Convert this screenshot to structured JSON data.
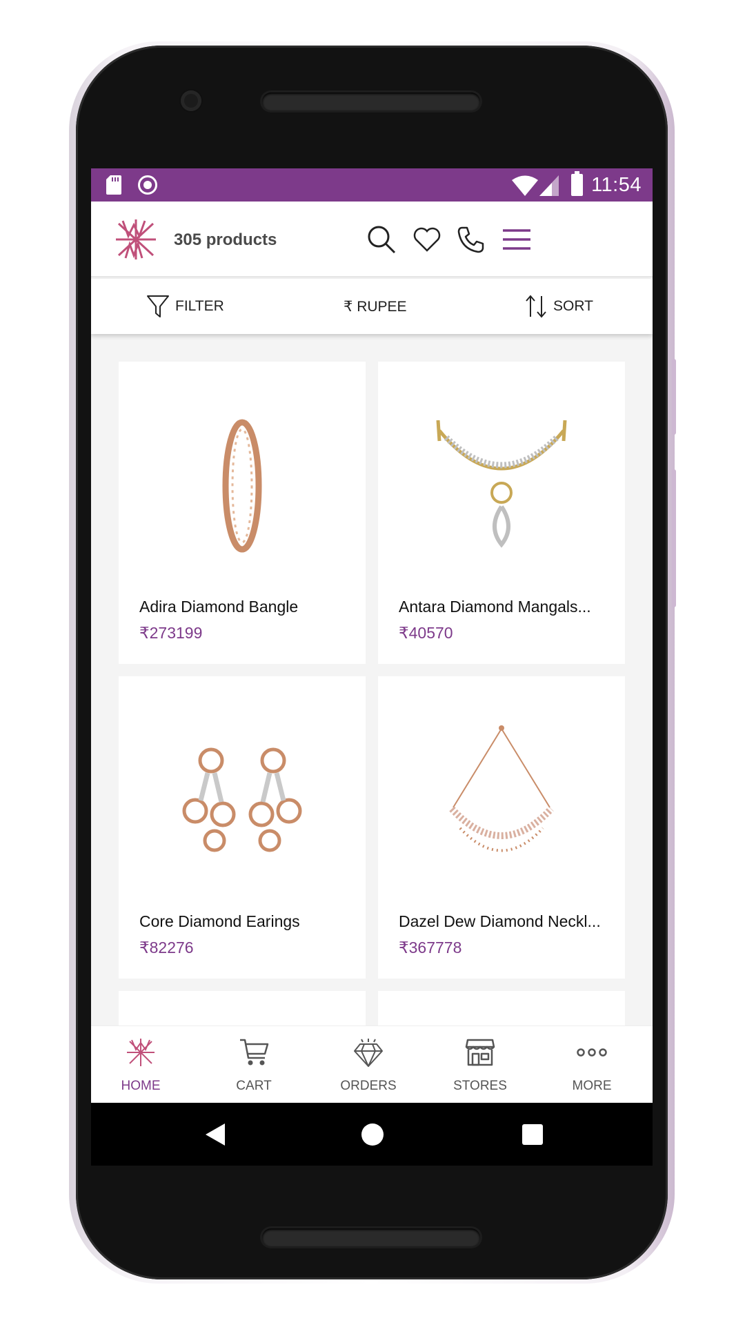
{
  "status_bar": {
    "time": "11:54"
  },
  "header": {
    "product_count": "305 products",
    "icons": [
      "brand-logo",
      "search-icon",
      "heart-icon",
      "phone-icon",
      "menu-icon"
    ]
  },
  "filter_bar": {
    "filter_label": "FILTER",
    "currency_label": "₹ RUPEE",
    "sort_label": "SORT"
  },
  "products": [
    {
      "name": "Adira Diamond Bangle",
      "price": "₹273199"
    },
    {
      "name": "Antara Diamond Mangals...",
      "price": "₹40570"
    },
    {
      "name": "Core Diamond Earings",
      "price": "₹82276"
    },
    {
      "name": "Dazel Dew Diamond Neckl...",
      "price": "₹367778"
    }
  ],
  "bottom_nav": [
    {
      "label": "HOME",
      "icon": "home-logo-icon",
      "active": true
    },
    {
      "label": "CART",
      "icon": "cart-icon",
      "active": false
    },
    {
      "label": "ORDERS",
      "icon": "diamond-icon",
      "active": false
    },
    {
      "label": "STORES",
      "icon": "store-icon",
      "active": false
    },
    {
      "label": "MORE",
      "icon": "more-dots-icon",
      "active": false
    }
  ],
  "colors": {
    "brand": "#7d3a8a",
    "logo_pink": "#c0507a",
    "background": "#f4f4f4"
  }
}
